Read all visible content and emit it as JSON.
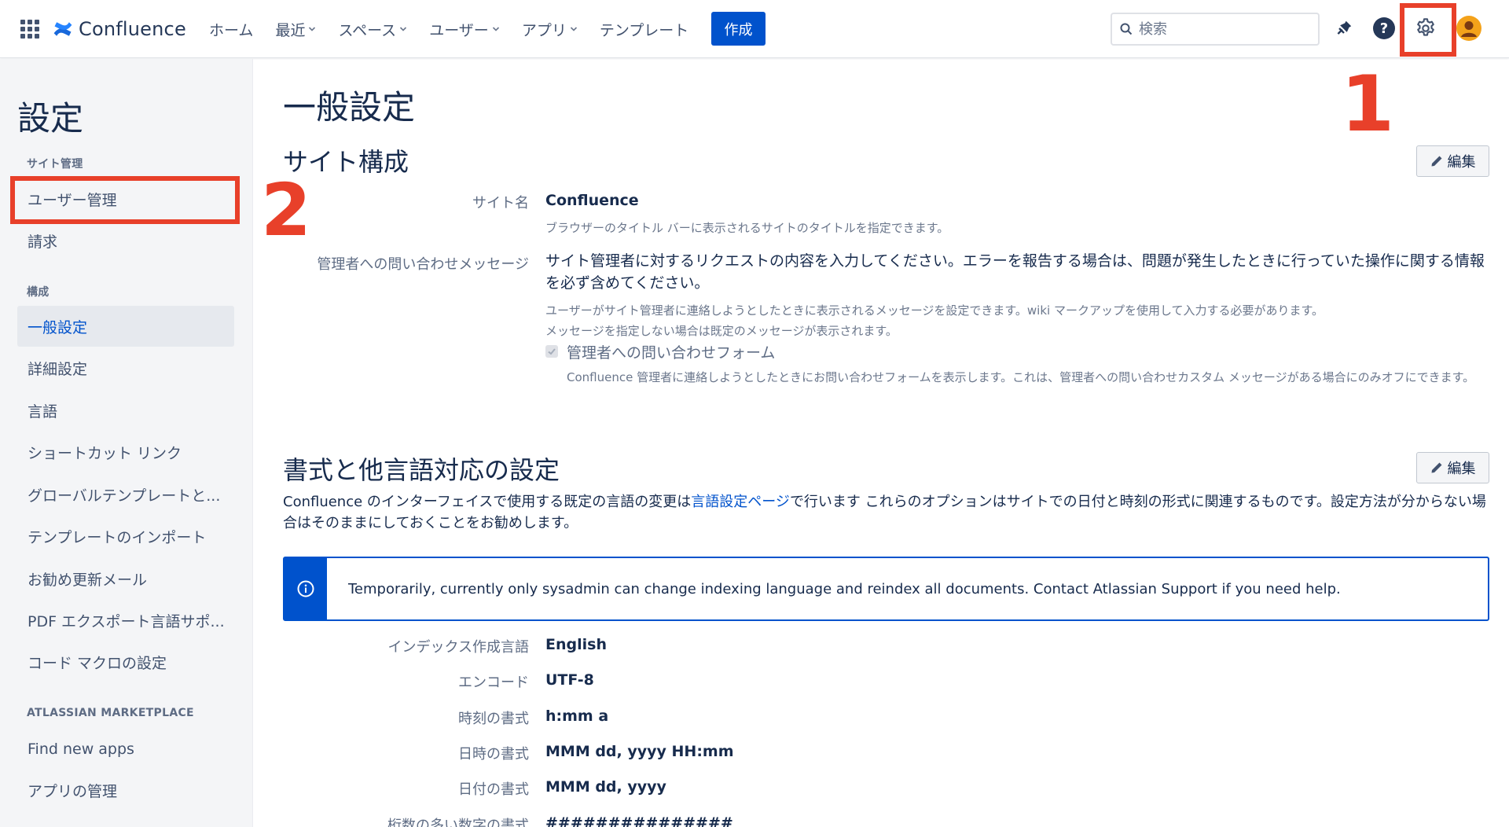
{
  "header": {
    "logo_text": "Confluence",
    "nav": [
      {
        "label": "ホーム",
        "dropdown": false
      },
      {
        "label": "最近",
        "dropdown": true
      },
      {
        "label": "スペース",
        "dropdown": true
      },
      {
        "label": "ユーザー",
        "dropdown": true
      },
      {
        "label": "アプリ",
        "dropdown": true
      },
      {
        "label": "テンプレート",
        "dropdown": false
      }
    ],
    "create_label": "作成",
    "search_placeholder": "検索",
    "icons": [
      "notifications-icon",
      "help-icon",
      "settings-gear-icon",
      "avatar-icon"
    ],
    "brand_color": "#0052cc"
  },
  "annotations": {
    "one": "1",
    "two": "2",
    "color": "#e8402a"
  },
  "sidebar": {
    "title": "設定",
    "section_site_admin": "サイト管理",
    "item_user_mgmt": "ユーザー管理",
    "item_billing": "請求",
    "section_config": "構成",
    "items_config": [
      "一般設定",
      "詳細設定",
      "言語",
      "ショートカット リンク",
      "グローバルテンプレートと...",
      "テンプレートのインポート",
      "お勧め更新メール",
      "PDF エクスポート言語サポ...",
      "コード マクロの設定"
    ],
    "section_marketplace": "ATLASSIAN MARKETPLACE",
    "item_find_apps": "Find new apps",
    "item_manage_apps": "アプリの管理"
  },
  "main": {
    "page_title": "一般設定",
    "site_config": {
      "title": "サイト構成",
      "edit_label": "編集",
      "site_name_label": "サイト名",
      "site_name_value": "Confluence",
      "site_name_desc": "ブラウザーのタイトル バーに表示されるサイトのタイトルを指定できます。",
      "contact_label": "管理者への問い合わせメッセージ",
      "contact_value": "サイト管理者に対するリクエストの内容を入力してください。エラーを報告する場合は、問題が発生したときに行っていた操作に関する情報を必ず含めてください。",
      "contact_desc1": "ユーザーがサイト管理者に連絡しようとしたときに表示されるメッセージを設定できます。wiki マークアップを使用して入力する必要があります。",
      "contact_desc2": "メッセージを指定しない場合は既定のメッセージが表示されます。",
      "form_checkbox_label": "管理者への問い合わせフォーム",
      "form_checkbox_checked": true,
      "form_desc": "Confluence 管理者に連絡しようとしたときにお問い合わせフォームを表示します。これは、管理者への問い合わせカスタム メッセージがある場合にのみオフにできます。"
    },
    "format": {
      "title": "書式と他言語対応の設定",
      "edit_label": "編集",
      "intro_before": "Confluence のインターフェイスで使用する既定の言語の変更は",
      "intro_link": "言語設定ページ",
      "intro_after": "で行います これらのオプションはサイトでの日付と時刻の形式に関連するものです。設定方法が分からない場合はそのままにしておくことをお勧めします。",
      "info_text": "Temporarily, currently only sysadmin can change indexing language and reindex all documents. Contact Atlassian Support if you need help.",
      "rows": [
        {
          "label": "インデックス作成言語",
          "value": "English"
        },
        {
          "label": "エンコード",
          "value": "UTF-8"
        },
        {
          "label": "時刻の書式",
          "value": "h:mm a"
        },
        {
          "label": "日時の書式",
          "value": "MMM dd, yyyy HH:mm"
        },
        {
          "label": "日付の書式",
          "value": "MMM dd, yyyy"
        },
        {
          "label": "桁数の多い数字の書式",
          "value": "###############"
        }
      ]
    }
  }
}
